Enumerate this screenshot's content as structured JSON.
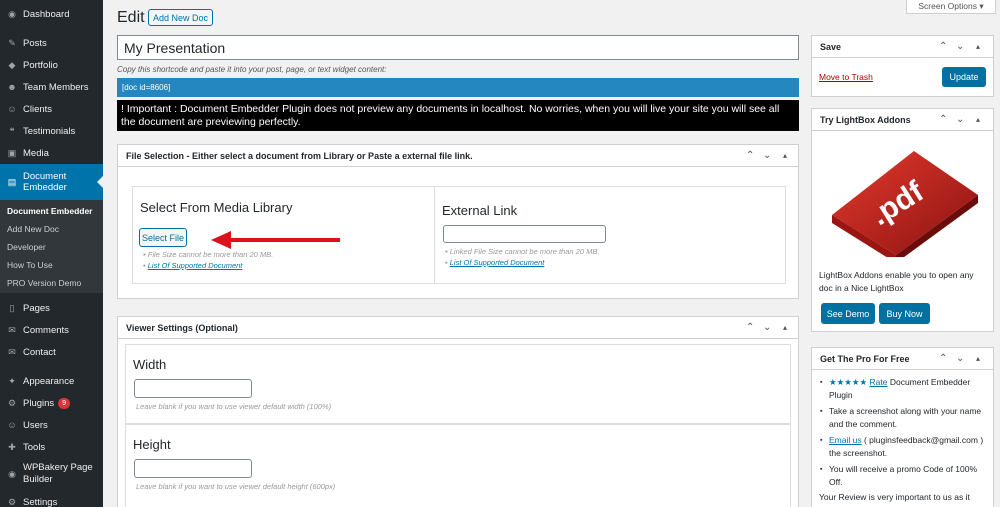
{
  "sidebar": {
    "items": [
      {
        "icon": "dashboard-icon",
        "glyph": "◉",
        "label": "Dashboard"
      },
      {
        "icon": "pin-icon",
        "glyph": "✎",
        "label": "Posts"
      },
      {
        "icon": "portfolio-icon",
        "glyph": "◆",
        "label": "Portfolio"
      },
      {
        "icon": "team-icon",
        "glyph": "☻",
        "label": "Team Members"
      },
      {
        "icon": "clients-icon",
        "glyph": "☺",
        "label": "Clients"
      },
      {
        "icon": "testimonials-icon",
        "glyph": "❝",
        "label": "Testimonials"
      },
      {
        "icon": "media-icon",
        "glyph": "▣",
        "label": "Media"
      },
      {
        "icon": "document-icon",
        "glyph": "▤",
        "label": "Document Embedder"
      },
      {
        "icon": "pages-icon",
        "glyph": "▯",
        "label": "Pages"
      },
      {
        "icon": "comments-icon",
        "glyph": "✉",
        "label": "Comments"
      },
      {
        "icon": "contact-icon",
        "glyph": "✉",
        "label": "Contact"
      },
      {
        "icon": "appearance-icon",
        "glyph": "✦",
        "label": "Appearance"
      },
      {
        "icon": "plugins-icon",
        "glyph": "⚙",
        "label": "Plugins",
        "badge": "9"
      },
      {
        "icon": "users-icon",
        "glyph": "☺",
        "label": "Users"
      },
      {
        "icon": "tools-icon",
        "glyph": "✚",
        "label": "Tools"
      },
      {
        "icon": "wpbakery-icon",
        "glyph": "◉",
        "label": "WPBakery Page Builder"
      },
      {
        "icon": "settings-icon",
        "glyph": "⚙",
        "label": "Settings"
      }
    ],
    "submenu": [
      "Document Embedder",
      "Add New Doc",
      "Developer",
      "How To Use",
      "PRO Version Demo"
    ]
  },
  "header": {
    "title": "Edit",
    "add_new": "Add New Doc",
    "screen_options": "Screen Options ▾"
  },
  "post": {
    "title_value": "My Presentation",
    "shortcode_note": "Copy this shortcode and paste it into your post, page, or text widget content:",
    "shortcode": "[doc id=8606]",
    "warning": "! Important : Document Embedder Plugin does not preview any documents in localhost. No worries, when you will live your site you will see all the document are previewing perfectly."
  },
  "file_selection": {
    "header": "File Selection - Either select a document from Library or Paste a external file link.",
    "library_title": "Select From Media Library",
    "select_button": "Select File",
    "library_hint1": "File Size cannot be more than 20 MB.",
    "library_hint2": "List Of Supported Document",
    "external_title": "External Link",
    "external_hint1": "Linked File Size cannot be more than 20 MB.",
    "external_hint2": "List Of Supported Document"
  },
  "viewer": {
    "header": "Viewer Settings (Optional)",
    "width_label": "Width",
    "width_hint": "Leave blank if you want to use viewer default width (100%)",
    "height_label": "Height",
    "height_hint": "Leave blank if you want to use viewer default height (600px)"
  },
  "save_box": {
    "header": "Save",
    "trash": "Move to Trash",
    "update": "Update"
  },
  "lightbox_box": {
    "header": "Try LightBox Addons",
    "pdf_text": ".pdf",
    "desc": "LightBox Addons enable you to open any doc in a Nice LightBox",
    "see_demo": "See Demo",
    "buy_now": "Buy Now"
  },
  "pro_box": {
    "header": "Get The Pro For Free",
    "stars": "★★★★★",
    "rate_link": "Rate",
    "rate_text": "Document Embedder Plugin",
    "item2": "Take a screenshot along with your name and the comment.",
    "email_link": "Email us",
    "email_text": "( pluginsfeedback@gmail.com ) the screenshot.",
    "item4": "You will receive a promo Code of 100% Off.",
    "footer": "Your Review is very important to us as it"
  },
  "colors": {
    "accent": "#0073aa",
    "sidebar_bg": "#23282d",
    "shortcode_bg": "#2587bf",
    "arrow": "#e0101a"
  }
}
